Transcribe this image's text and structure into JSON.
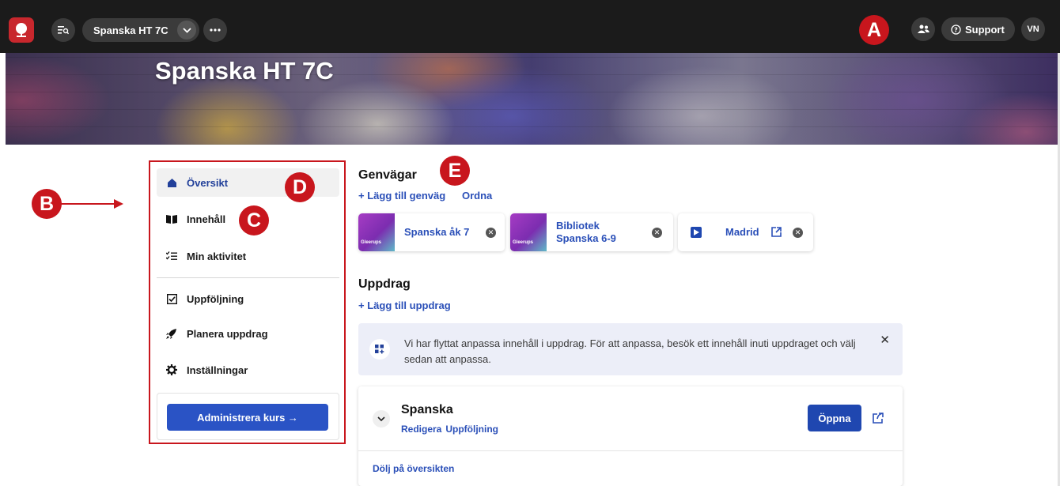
{
  "topbar": {
    "course_name": "Spanska HT 7C",
    "support_label": "Support",
    "user_initials": "VN"
  },
  "banner": {
    "title": "Spanska HT 7C"
  },
  "markers": {
    "a": "A",
    "b": "B",
    "c": "C",
    "d": "D",
    "e": "E"
  },
  "sidebar": {
    "items": [
      {
        "label": "Översikt",
        "icon": "home-icon"
      },
      {
        "label": "Innehåll",
        "icon": "book-icon"
      },
      {
        "label": "Min aktivitet",
        "icon": "checklist-icon"
      },
      {
        "label": "Uppföljning",
        "icon": "checkbox-icon"
      },
      {
        "label": "Planera uppdrag",
        "icon": "rocket-icon"
      },
      {
        "label": "Inställningar",
        "icon": "gear-icon"
      }
    ],
    "admin_button": "Administrera kurs →"
  },
  "shortcuts": {
    "heading": "Genvägar",
    "add_label": "+ Lägg till genväg",
    "order_label": "Ordna",
    "items": [
      {
        "line1": "Spanska åk 7",
        "line2": ""
      },
      {
        "line1": "Bibliotek",
        "line2": "Spanska 6-9"
      },
      {
        "line1": "Madrid",
        "line2": ""
      }
    ],
    "thumb_brand": "Gleerups"
  },
  "assignments": {
    "heading": "Uppdrag",
    "add_label": "+ Lägg till uppdrag",
    "info_text": "Vi har flyttat anpassa innehåll i uppdrag. För att anpassa, besök ett innehåll inuti uppdraget och välj sedan att anpassa.",
    "card": {
      "title": "Spanska",
      "edit_label": "Redigera",
      "followup_label": "Uppföljning",
      "open_label": "Öppna",
      "hide_label": "Dölj på översikten"
    }
  },
  "colors": {
    "accent": "#2a53c5",
    "marker": "#c8161d",
    "topbar": "#1b1b1b"
  }
}
